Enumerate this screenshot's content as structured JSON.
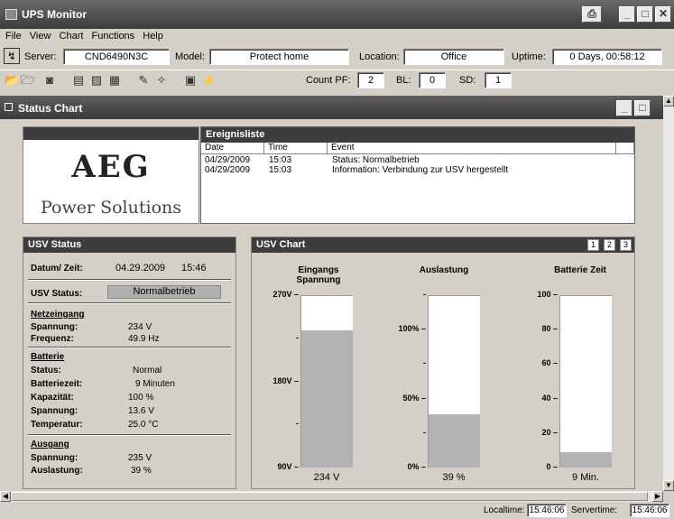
{
  "app": {
    "title": "UPS Monitor"
  },
  "menu": [
    "File",
    "View",
    "Chart",
    "Functions",
    "Help"
  ],
  "server_row": {
    "server_label": "Server:",
    "server_value": "CND6490N3C",
    "model_label": "Model:",
    "model_value": "Protect home",
    "location_label": "Location:",
    "location_value": "Office",
    "uptime_label": "Uptime:",
    "uptime_value": "0 Days, 00:58:12"
  },
  "toolbar": {
    "count_pf_label": "Count PF:",
    "count_pf_value": "2",
    "bl_label": "BL:",
    "bl_value": "0",
    "sd_label": "SD:",
    "sd_value": "1"
  },
  "inner_window": {
    "title": "Status Chart"
  },
  "logo": {
    "brand": "AEG",
    "subtitle": "Power Solutions"
  },
  "events": {
    "title": "Ereignisliste",
    "columns": [
      "Date",
      "Time",
      "Event"
    ],
    "rows": [
      {
        "date": "04/29/2009",
        "time": "15:03",
        "event": "Status: Normalbetrieb"
      },
      {
        "date": "04/29/2009",
        "time": "15:03",
        "event": "Information: Verbindung zur USV hergestellt"
      }
    ]
  },
  "usv_status": {
    "title": "USV Status",
    "datetime_label": "Datum/ Zeit:",
    "date": "04.29.2009",
    "time": "15:46",
    "status_label": "USV Status:",
    "status_value": "Normalbetrieb",
    "netzeingang": {
      "title": "Netzeingang",
      "spannung_label": "Spannung:",
      "spannung": "234 V",
      "frequenz_label": "Frequenz:",
      "frequenz": "49.9 Hz"
    },
    "batterie": {
      "title": "Batterie",
      "status_label": "Status:",
      "status": "Normal",
      "zeit_label": "Batteriezeit:",
      "zeit": "9 Minuten",
      "kap_label": "Kapazität:",
      "kap": "100 %",
      "spannung_label": "Spannung:",
      "spannung": "13.6 V",
      "temp_label": "Temperatur:",
      "temp": "25.0 °C"
    },
    "ausgang": {
      "title": "Ausgang",
      "spannung_label": "Spannung:",
      "spannung": "235 V",
      "last_label": "Auslastung:",
      "last": "39 %"
    }
  },
  "chart": {
    "title": "USV Chart",
    "buttons": [
      "1",
      "2",
      "3"
    ]
  },
  "chart_data": [
    {
      "type": "bar",
      "title": "Eingangs Spannung",
      "value": 234,
      "value_label": "234 V",
      "ylim": [
        90,
        270
      ],
      "tick_labels": [
        "270V",
        "-",
        "180V",
        "-",
        "90V"
      ]
    },
    {
      "type": "bar",
      "title": "Auslastung",
      "value": 39,
      "value_label": "39 %",
      "ylim": [
        0,
        125
      ],
      "tick_labels": [
        "-",
        "100%",
        "-",
        "50%",
        "-",
        "0%"
      ]
    },
    {
      "type": "bar",
      "title": "Batterie Zeit",
      "value": 9,
      "value_label": "9 Min.",
      "ylim": [
        0,
        100
      ],
      "tick_labels": [
        "100",
        "80",
        "60",
        "40",
        "20",
        "0"
      ]
    }
  ],
  "statusbar": {
    "localtime_label": "Localtime:",
    "localtime": "15:46:06",
    "servertime_label": "Servertime:",
    "servertime": "15:46:06"
  }
}
